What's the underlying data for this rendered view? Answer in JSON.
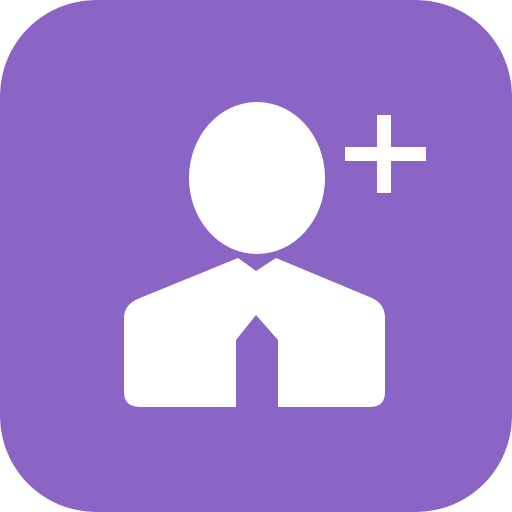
{
  "app_icon": {
    "name": "add-user-icon",
    "glyph_name": "user-with-tie-icon",
    "badge_name": "plus-icon",
    "colors": {
      "background": "#8B65C5",
      "foreground": "#FFFFFF"
    }
  }
}
